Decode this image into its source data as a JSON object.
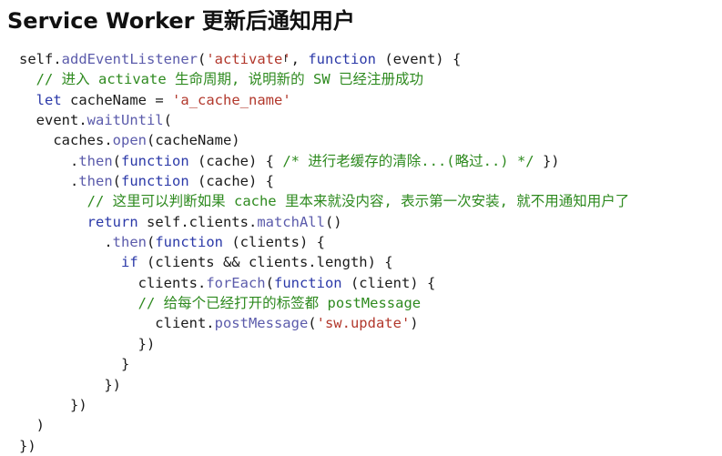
{
  "title": "Service Worker 更新后通知用户",
  "cursor_glyph": "I",
  "colors": {
    "plain": "#1a1a1a",
    "method": "#5b5bab",
    "keyword": "#2b39a8",
    "string": "#b2382c",
    "comment": "#2e8a1f"
  },
  "code_lines": [
    [
      {
        "t": "self.",
        "c": "var"
      },
      {
        "t": "addEventListener",
        "c": "method"
      },
      {
        "t": "(",
        "c": "plain"
      },
      {
        "t": "'activate'",
        "c": "str"
      },
      {
        "t": ", ",
        "c": "plain"
      },
      {
        "t": "function",
        "c": "kw"
      },
      {
        "t": " (event) {",
        "c": "plain"
      }
    ],
    [
      {
        "t": "  ",
        "c": "plain"
      },
      {
        "t": "// 进入 activate 生命周期, 说明新的 SW 已经注册成功",
        "c": "cmt"
      }
    ],
    [
      {
        "t": "  ",
        "c": "plain"
      },
      {
        "t": "let",
        "c": "kw"
      },
      {
        "t": " cacheName = ",
        "c": "plain"
      },
      {
        "t": "'a_cache_name'",
        "c": "str"
      }
    ],
    [
      {
        "t": "  event.",
        "c": "var"
      },
      {
        "t": "waitUntil",
        "c": "method"
      },
      {
        "t": "(",
        "c": "plain"
      }
    ],
    [
      {
        "t": "    caches.",
        "c": "var"
      },
      {
        "t": "open",
        "c": "method"
      },
      {
        "t": "(cacheName)",
        "c": "plain"
      }
    ],
    [
      {
        "t": "      .",
        "c": "plain"
      },
      {
        "t": "then",
        "c": "method"
      },
      {
        "t": "(",
        "c": "plain"
      },
      {
        "t": "function",
        "c": "kw"
      },
      {
        "t": " (cache) { ",
        "c": "plain"
      },
      {
        "t": "/* 进行老缓存的清除...(略过..) */",
        "c": "cmt"
      },
      {
        "t": " })",
        "c": "plain"
      }
    ],
    [
      {
        "t": "      .",
        "c": "plain"
      },
      {
        "t": "then",
        "c": "method"
      },
      {
        "t": "(",
        "c": "plain"
      },
      {
        "t": "function",
        "c": "kw"
      },
      {
        "t": " (cache) {",
        "c": "plain"
      }
    ],
    [
      {
        "t": "        ",
        "c": "plain"
      },
      {
        "t": "// 这里可以判断如果 cache 里本来就没内容, 表示第一次安装, 就不用通知用户了",
        "c": "cmt"
      }
    ],
    [
      {
        "t": "        ",
        "c": "plain"
      },
      {
        "t": "return",
        "c": "kw"
      },
      {
        "t": " self.clients.",
        "c": "var"
      },
      {
        "t": "matchAll",
        "c": "method"
      },
      {
        "t": "()",
        "c": "plain"
      }
    ],
    [
      {
        "t": "          .",
        "c": "plain"
      },
      {
        "t": "then",
        "c": "method"
      },
      {
        "t": "(",
        "c": "plain"
      },
      {
        "t": "function",
        "c": "kw"
      },
      {
        "t": " (clients) {",
        "c": "plain"
      }
    ],
    [
      {
        "t": "            ",
        "c": "plain"
      },
      {
        "t": "if",
        "c": "kw"
      },
      {
        "t": " (clients && clients.length) {",
        "c": "plain"
      }
    ],
    [
      {
        "t": "              clients.",
        "c": "var"
      },
      {
        "t": "forEach",
        "c": "method"
      },
      {
        "t": "(",
        "c": "plain"
      },
      {
        "t": "function",
        "c": "kw"
      },
      {
        "t": " (client) {",
        "c": "plain"
      }
    ],
    [
      {
        "t": "              ",
        "c": "plain"
      },
      {
        "t": "// 给每个已经打开的标签都 postMessage",
        "c": "cmt"
      }
    ],
    [
      {
        "t": "                client.",
        "c": "var"
      },
      {
        "t": "postMessage",
        "c": "method"
      },
      {
        "t": "(",
        "c": "plain"
      },
      {
        "t": "'sw.update'",
        "c": "str"
      },
      {
        "t": ")",
        "c": "plain"
      }
    ],
    [
      {
        "t": "              })",
        "c": "plain"
      }
    ],
    [
      {
        "t": "            }",
        "c": "plain"
      }
    ],
    [
      {
        "t": "          })",
        "c": "plain"
      }
    ],
    [
      {
        "t": "      })",
        "c": "plain"
      }
    ],
    [
      {
        "t": "  )",
        "c": "plain"
      }
    ],
    [
      {
        "t": "})",
        "c": "plain"
      }
    ]
  ]
}
